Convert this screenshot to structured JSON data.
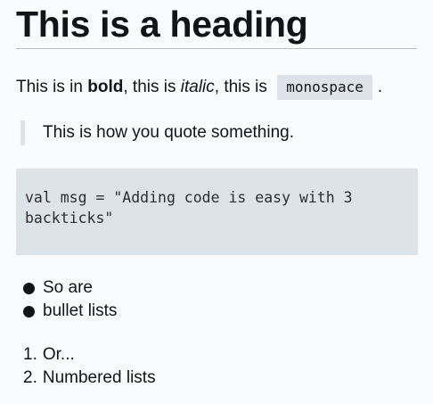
{
  "heading": "This is a heading",
  "paragraph": {
    "part1": "This is in ",
    "bold": "bold",
    "part2": ", this is ",
    "italic": "italic",
    "part3": ", this is ",
    "mono": "monospace",
    "end": "."
  },
  "quote": "This is how you quote something.",
  "code": "val msg = \"Adding code is easy with 3\nbackticks\"",
  "bullet_list": [
    "So are",
    "bullet lists"
  ],
  "numbered_list": [
    {
      "num": "1.",
      "text": "Or..."
    },
    {
      "num": "2.",
      "text": "Numbered lists"
    }
  ],
  "colors": {
    "background": "#fafbfd",
    "code_background": "#dce3e9",
    "text": "#111418",
    "divider": "#b9bdc2",
    "quote_bar": "#dfe2e6"
  }
}
